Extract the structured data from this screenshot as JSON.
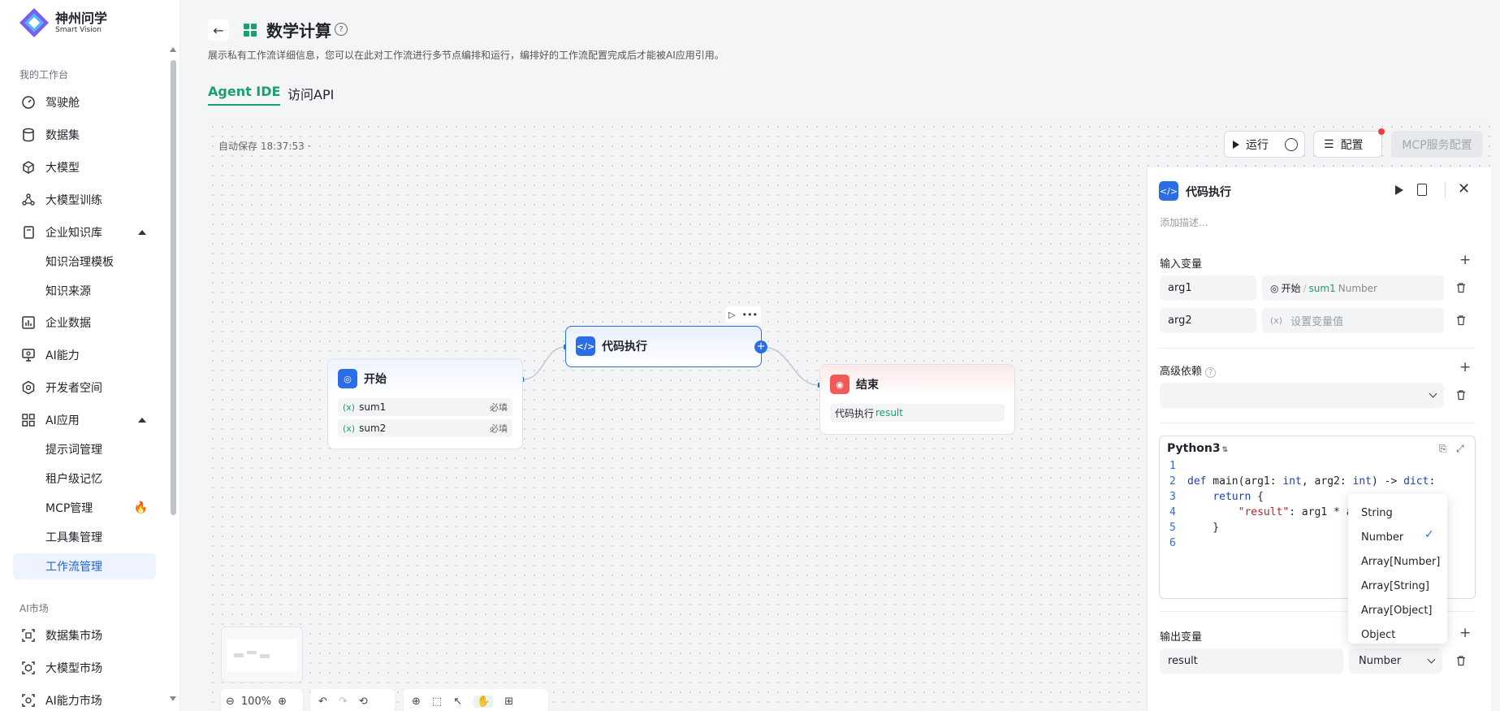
{
  "brand": {
    "name": "神州问学",
    "subtitle": "Smart Vision"
  },
  "sidebar": {
    "section1": "我的工作台",
    "section2": "AI市场",
    "items": [
      {
        "label": "驾驶舱",
        "icon": "dashboard-icon"
      },
      {
        "label": "数据集",
        "icon": "database-icon"
      },
      {
        "label": "大模型",
        "icon": "cube-icon"
      },
      {
        "label": "大模型训练",
        "icon": "training-icon"
      },
      {
        "label": "企业知识库",
        "icon": "book-icon"
      },
      {
        "label": "知识治理模板"
      },
      {
        "label": "知识来源"
      },
      {
        "label": "企业数据",
        "icon": "chart-icon"
      },
      {
        "label": "AI能力",
        "icon": "monitor-icon"
      },
      {
        "label": "开发者空间",
        "icon": "hexagon-icon"
      },
      {
        "label": "AI应用",
        "icon": "grid-icon"
      },
      {
        "label": "提示词管理"
      },
      {
        "label": "租户级记忆"
      },
      {
        "label": "MCP管理"
      },
      {
        "label": "工具集管理"
      },
      {
        "label": "工作流管理"
      }
    ],
    "market": [
      {
        "label": "数据集市场"
      },
      {
        "label": "大模型市场"
      },
      {
        "label": "AI能力市场"
      }
    ]
  },
  "header": {
    "title": "数学计算",
    "description": "展示私有工作流详细信息，您可以在此对工作流进行多节点编排和运行，编排好的工作流配置完成后才能被AI应用引用。",
    "tabs": [
      "Agent IDE",
      "访问API"
    ]
  },
  "canvas": {
    "autosave": "自动保存 18:37:53 ·",
    "toolbar": {
      "run": "运行",
      "config": "配置",
      "mcp": "MCP服务配置"
    },
    "zoom": "100%"
  },
  "nodes": {
    "start": {
      "title": "开始",
      "vars": [
        {
          "x": "(x)",
          "name": "sum1",
          "req": "必填"
        },
        {
          "x": "(x)",
          "name": "sum2",
          "req": "必填"
        }
      ]
    },
    "code": {
      "title": "代码执行"
    },
    "end": {
      "title": "结束",
      "ref_node": "代码执行",
      "ref_var": "result"
    }
  },
  "panel": {
    "title": "代码执行",
    "desc_placeholder": "添加描述...",
    "inputs_label": "输入变量",
    "inputs": [
      {
        "name": "arg1",
        "src_node": "开始",
        "src_var": "sum1",
        "src_type": "Number"
      },
      {
        "name": "arg2",
        "placeholder": "设置变量值",
        "x": "(x)"
      }
    ],
    "advanced_label": "高级依赖",
    "editor": {
      "lang": "Python3",
      "lines": [
        "",
        "def main(arg1: int, arg2: int) -> dict:",
        "    return {",
        "        \"result\": arg1 * a",
        "    }",
        ""
      ]
    },
    "outputs_label": "输出变量",
    "output": {
      "name": "result",
      "type": "Number"
    },
    "type_options": [
      "String",
      "Number",
      "Array[Number]",
      "Array[String]",
      "Array[Object]",
      "Object"
    ],
    "type_selected": "Number"
  },
  "colors": {
    "accent_green": "#1aa06d",
    "accent_blue": "#2b6de6",
    "end_red": "#f25a5a"
  }
}
